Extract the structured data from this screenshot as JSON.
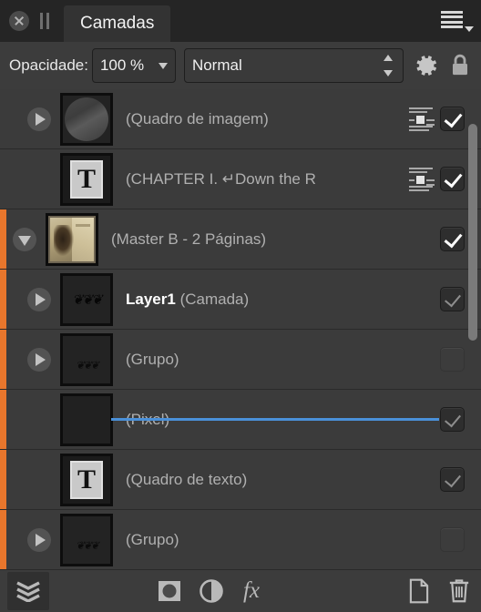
{
  "titlebar": {
    "close_icon": "close-icon",
    "pause_icon": "pause-icon",
    "tab_label": "Camadas",
    "menu_icon": "panel-menu-icon"
  },
  "options": {
    "opacity_label": "Opacidade:",
    "opacity_value": "100 %",
    "blend_mode": "Normal",
    "gear_icon": "gear-icon",
    "lock_icon": "lock-icon"
  },
  "accent_colors": {
    "selection_strip": "#e8762c",
    "drop_indicator": "#4a90d9",
    "tab_active_bg": "#333333",
    "panel_bg": "#3b3b3b"
  },
  "layers": [
    {
      "name": "(Quadro de imagem)",
      "bold_prefix": "",
      "thumb": "image-frame-thumbnail",
      "disclosure": "collapsed",
      "selected": false,
      "has_wrap_icon": true,
      "visible_state": "checked-bright"
    },
    {
      "name": "(CHAPTER I. ↵Down the R",
      "bold_prefix": "",
      "thumb": "text-frame-thumbnail",
      "disclosure": "none",
      "selected": false,
      "has_wrap_icon": true,
      "visible_state": "checked-bright"
    },
    {
      "name": "(Master B - 2 Páginas)",
      "bold_prefix": "",
      "thumb": "master-page-thumbnail",
      "disclosure": "expanded",
      "selected": true,
      "has_wrap_icon": false,
      "visible_state": "checked-bright"
    },
    {
      "name": "(Camada)",
      "bold_prefix": "Layer1",
      "thumb": "ornament-thumbnail",
      "disclosure": "collapsed",
      "selected": true,
      "has_wrap_icon": false,
      "visible_state": "checked-dim"
    },
    {
      "name": "(Grupo)",
      "bold_prefix": "",
      "thumb": "ornament-low-thumbnail",
      "disclosure": "collapsed",
      "selected": true,
      "has_wrap_icon": false,
      "visible_state": "unchecked"
    },
    {
      "name": "(Pixel)",
      "bold_prefix": "",
      "thumb": "blank-thumbnail",
      "disclosure": "none",
      "selected": true,
      "has_wrap_icon": false,
      "visible_state": "checked-dim"
    },
    {
      "name": "(Quadro de texto)",
      "bold_prefix": "",
      "thumb": "text-frame-thumbnail",
      "disclosure": "none",
      "selected": true,
      "has_wrap_icon": false,
      "visible_state": "checked-dim"
    },
    {
      "name": "(Grupo)",
      "bold_prefix": "",
      "thumb": "ornament-low-thumbnail",
      "disclosure": "collapsed",
      "selected": true,
      "has_wrap_icon": false,
      "visible_state": "unchecked"
    }
  ],
  "bottombar": {
    "buttons": [
      {
        "icon": "layer-stack-icon",
        "label": ""
      },
      {
        "icon": "mask-icon",
        "label": ""
      },
      {
        "icon": "adjustment-icon",
        "label": ""
      },
      {
        "icon": "effects-fx-icon",
        "label": "fx"
      },
      {
        "icon": "new-layer-icon",
        "label": ""
      },
      {
        "icon": "delete-layer-icon",
        "label": ""
      }
    ],
    "fx_label": "fx"
  },
  "ornament_glyph": "❦❦❦",
  "text_thumb_glyph": "T"
}
